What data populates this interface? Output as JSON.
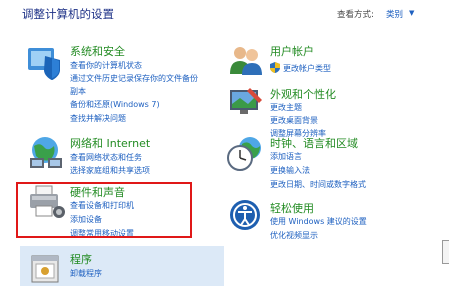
{
  "header": {
    "title": "调整计算机的设置",
    "view_by_label": "查看方式:",
    "view_by_value": "类别"
  },
  "categories_left": [
    {
      "id": "system",
      "title": "系统和安全",
      "links": [
        "查看你的计算机状态",
        "通过文件历史记录保存你的文件备份",
        "副本",
        "备份和还原(Windows 7)",
        "查找并解决问题"
      ]
    },
    {
      "id": "network",
      "title": "网络和 Internet",
      "links": [
        "查看网络状态和任务",
        "选择家庭组和共享选项"
      ]
    },
    {
      "id": "hardware",
      "title": "硬件和声音",
      "links": [
        "查看设备和打印机",
        "添加设备",
        "调整常用移动设置"
      ]
    },
    {
      "id": "programs",
      "title": "程序",
      "links": [
        "卸载程序"
      ]
    }
  ],
  "categories_right": [
    {
      "id": "user",
      "title": "用户帐户",
      "links": [
        "更改帐户类型"
      ]
    },
    {
      "id": "appearance",
      "title": "外观和个性化",
      "links": [
        "更改主题",
        "更改桌面背景",
        "调整屏幕分辨率"
      ]
    },
    {
      "id": "clock",
      "title": "时钟、语言和区域",
      "links": [
        "添加语言",
        "更换输入法",
        "更改日期、时间或数字格式"
      ]
    },
    {
      "id": "ease",
      "title": "轻松使用",
      "links": [
        "使用 Windows 建议的设置",
        "优化视频显示"
      ]
    }
  ],
  "colors": {
    "title_green": "#228b22",
    "link_blue": "#1e60c0",
    "highlight": "#e01818"
  }
}
